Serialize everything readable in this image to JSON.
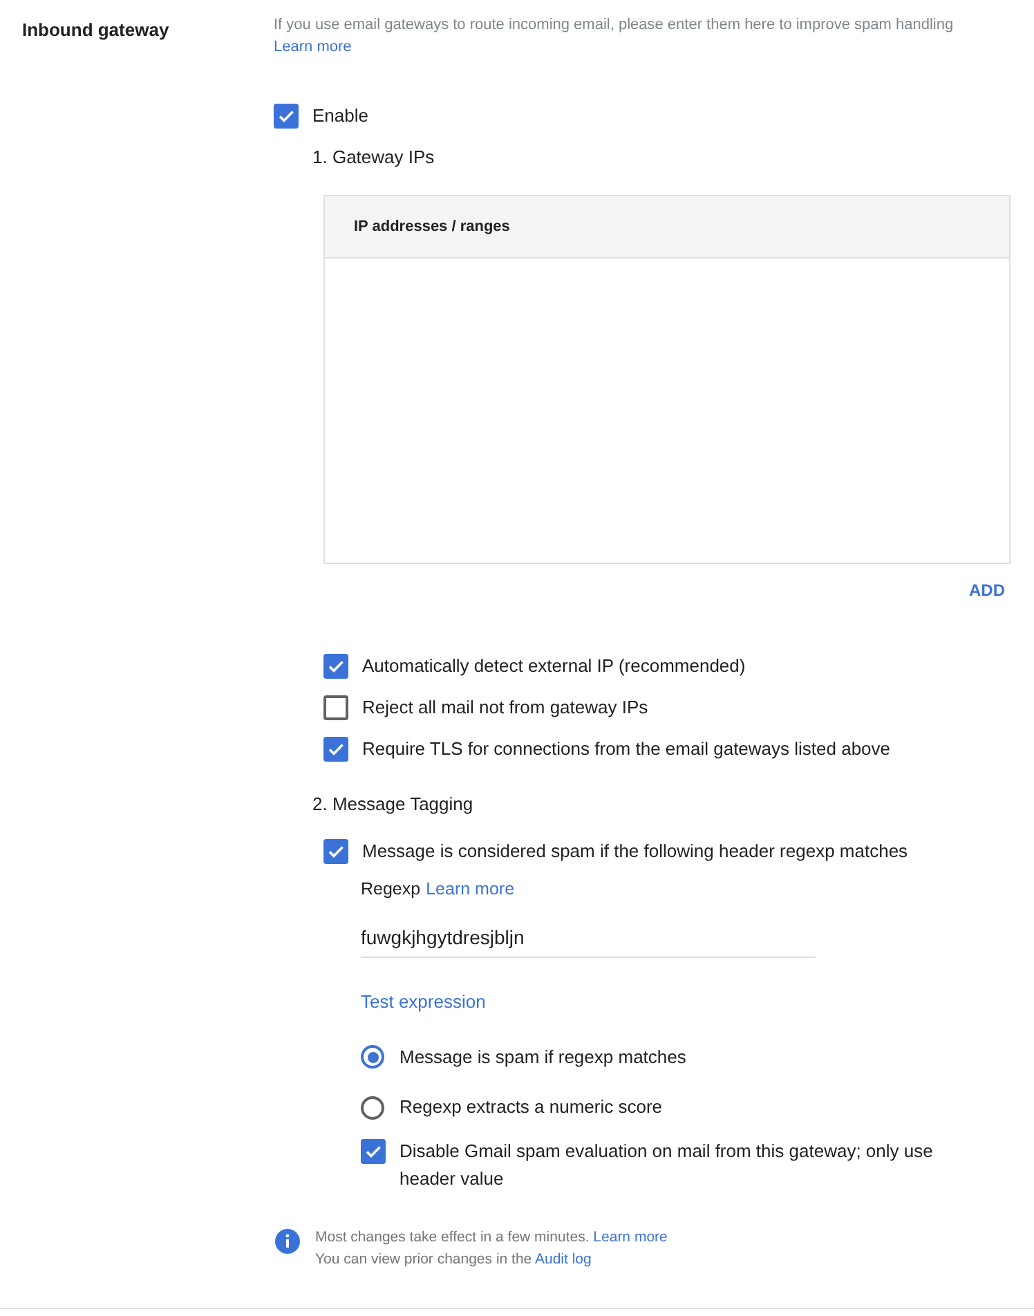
{
  "section_label": "Inbound gateway",
  "description": {
    "text": "If you use email gateways to route incoming email, please enter them here to improve spam handling",
    "link": "Learn more"
  },
  "enable": {
    "label": "Enable",
    "checked": true
  },
  "gateway_ips": {
    "heading": "1. Gateway IPs",
    "table": {
      "columns": [
        "IP addresses / ranges"
      ]
    },
    "add_button": "ADD",
    "options": [
      {
        "label": "Automatically detect external IP (recommended)",
        "checked": true
      },
      {
        "label": "Reject all mail not from gateway IPs",
        "checked": false
      },
      {
        "label": "Require TLS for connections from the email gateways listed above",
        "checked": true
      }
    ]
  },
  "message_tagging": {
    "heading": "2. Message Tagging",
    "rule": {
      "label": "Message is considered spam if the following header regexp matches",
      "checked": true
    },
    "regexp_label": "Regexp",
    "regexp_link": "Learn more",
    "regexp_value": "fuwgkjhgytdresjbljn",
    "test_link": "Test expression",
    "modes": [
      {
        "label": "Message is spam if regexp matches",
        "selected": true
      },
      {
        "label": "Regexp extracts a numeric score",
        "selected": false
      }
    ],
    "disable_gmail": {
      "label": "Disable Gmail spam evaluation on mail from this gateway; only use header value",
      "checked": true
    }
  },
  "footer_note": {
    "lines": [
      {
        "text": "Most changes take effect in a few minutes.",
        "link": "Learn more"
      },
      {
        "text": "You can view prior changes in the",
        "link": "Audit log"
      }
    ]
  }
}
